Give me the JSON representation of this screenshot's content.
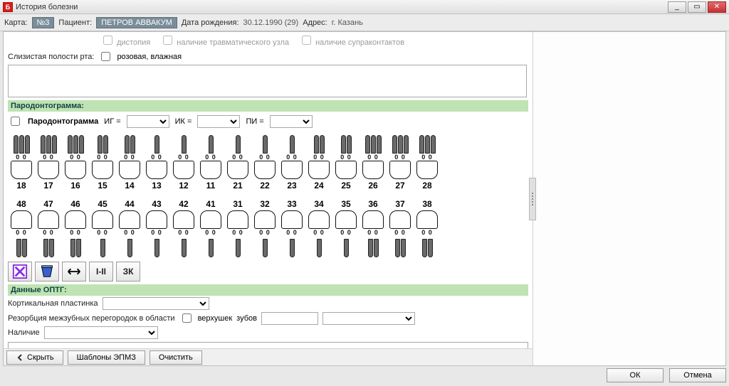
{
  "window": {
    "title": "История болезни",
    "controls": {
      "min": "_",
      "max": "▭",
      "close": "✕"
    }
  },
  "infobar": {
    "karta_label": "Карта:",
    "karta_value": "№3",
    "patient_label": "Пациент:",
    "patient_value": "ПЕТРОВ АВВАКУМ",
    "dob_label": "Дата рождения:",
    "dob_value": "30.12.1990  (29)",
    "address_label": "Адрес:",
    "address_value": "г. Казань"
  },
  "dimmed": {
    "c1": "дистопия",
    "c2": "наличие травматического узла",
    "c3": "наличие супраконтактов"
  },
  "slizist": {
    "label": "Слизистая полости рта:",
    "value": "розовая, влажная"
  },
  "parodont": {
    "section": "Пародонтограмма:",
    "title": "Пародонтограмма",
    "ig": "ИГ =",
    "ik": "ИК =",
    "pi": "ПИ ="
  },
  "teeth_upper": [
    "18",
    "17",
    "16",
    "15",
    "14",
    "13",
    "12",
    "11",
    "21",
    "22",
    "23",
    "24",
    "25",
    "26",
    "27",
    "28"
  ],
  "teeth_lower": [
    "48",
    "47",
    "46",
    "45",
    "44",
    "43",
    "42",
    "41",
    "31",
    "32",
    "33",
    "34",
    "35",
    "36",
    "37",
    "38"
  ],
  "root_counts_upper": [
    3,
    3,
    3,
    2,
    2,
    1,
    1,
    1,
    1,
    1,
    1,
    2,
    2,
    3,
    3,
    3
  ],
  "root_counts_lower": [
    2,
    2,
    2,
    1,
    1,
    1,
    1,
    1,
    1,
    1,
    1,
    1,
    1,
    2,
    2,
    2
  ],
  "score": "0 0",
  "toolbar": {
    "swap_label": "I-II",
    "zk_label": "ЗК"
  },
  "optg": {
    "section": "Данные ОПТГ:",
    "kortik": "Кортикальная пластинка",
    "resorb": "Резорбция  межзубных перегородок в области",
    "verh": "верхушек",
    "zub": "зубов",
    "nalich": "Наличие"
  },
  "bottom": {
    "hide": "Скрыть",
    "templates": "Шаблоны ЭПМЗ",
    "clear": "Очистить"
  },
  "footer": {
    "ok": "ОК",
    "cancel": "Отмена"
  }
}
